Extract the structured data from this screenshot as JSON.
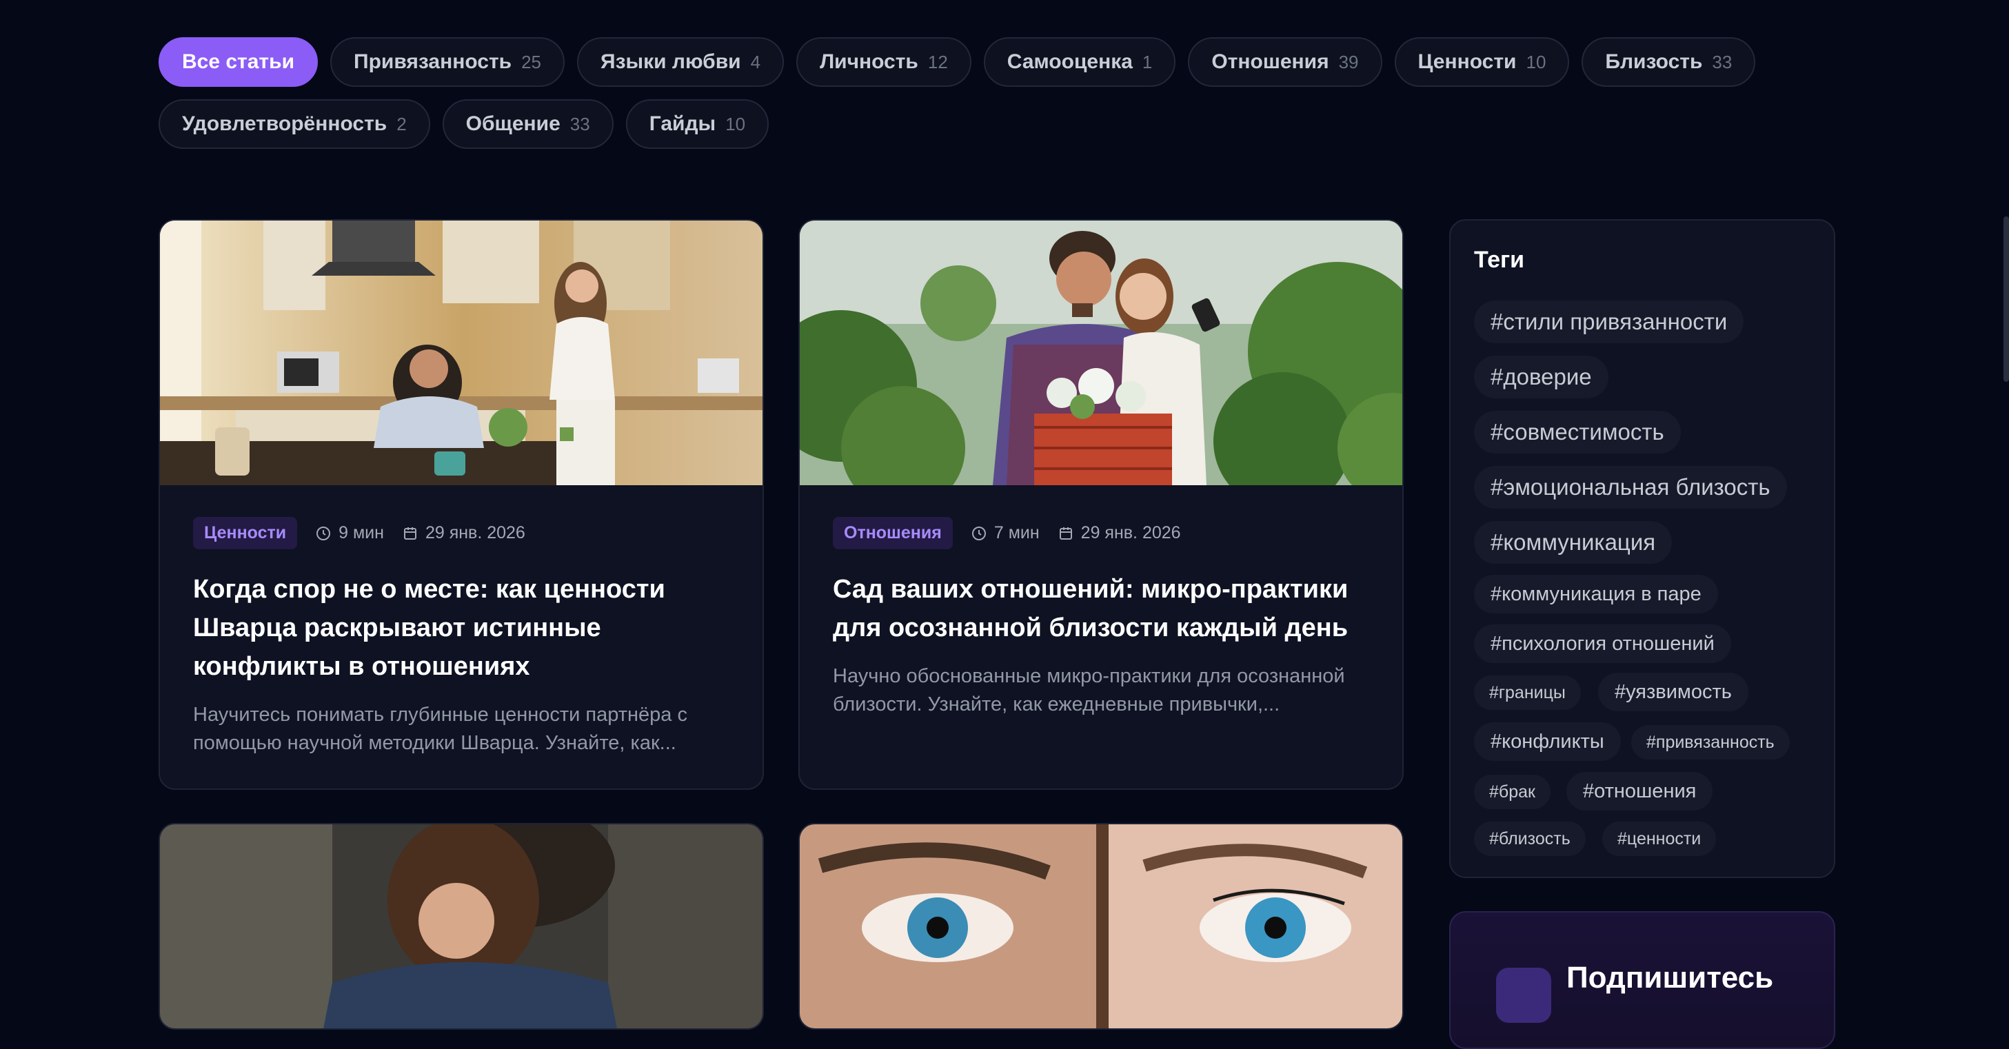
{
  "filters": {
    "row1": [
      {
        "label": "Все статьи",
        "count": "",
        "active": true
      },
      {
        "label": "Привязанность",
        "count": "25"
      },
      {
        "label": "Языки любви",
        "count": "4"
      },
      {
        "label": "Личность",
        "count": "12"
      },
      {
        "label": "Самооценка",
        "count": "1"
      },
      {
        "label": "Отношения",
        "count": "39"
      },
      {
        "label": "Ценности",
        "count": "10"
      },
      {
        "label": "Близость",
        "count": "33"
      }
    ],
    "row2": [
      {
        "label": "Удовлетворённость",
        "count": "2"
      },
      {
        "label": "Общение",
        "count": "33"
      },
      {
        "label": "Гайды",
        "count": "10"
      }
    ]
  },
  "articles": [
    {
      "category": "Ценности",
      "read_time": "9 мин",
      "date": "29 янв. 2026",
      "title": "Когда спор не о месте: как ценности Шварца раскрывают истинные конфликты в отношениях",
      "excerpt": "Научитесь понимать глубинные ценности партнёра с помощью научной методики Шварца. Узнайте, как..."
    },
    {
      "category": "Отношения",
      "read_time": "7 мин",
      "date": "29 янв. 2026",
      "title": "Сад ваших отношений: микро-практики для осознанной близости каждый день",
      "excerpt": "Научно обоснованные микро-практики для осознанной близости. Узнайте, как ежедневные привычки,..."
    }
  ],
  "sidebar": {
    "tags_title": "Теги",
    "tags": [
      "#стили привязанности",
      "#доверие",
      "#совместимость",
      "#эмоциональная близость",
      "#коммуникация",
      "#коммуникация в паре",
      "#психология отношений",
      "#границы",
      "#уязвимость",
      "#конфликты",
      "#привязанность",
      "#брак",
      "#отношения",
      "#близость",
      "#ценности"
    ],
    "subscribe_title": "Подпишитесь"
  },
  "colors": {
    "accent": "#8b5cf6",
    "background": "#050816",
    "card": "#0e1222",
    "badge_text": "#a78bfa"
  }
}
